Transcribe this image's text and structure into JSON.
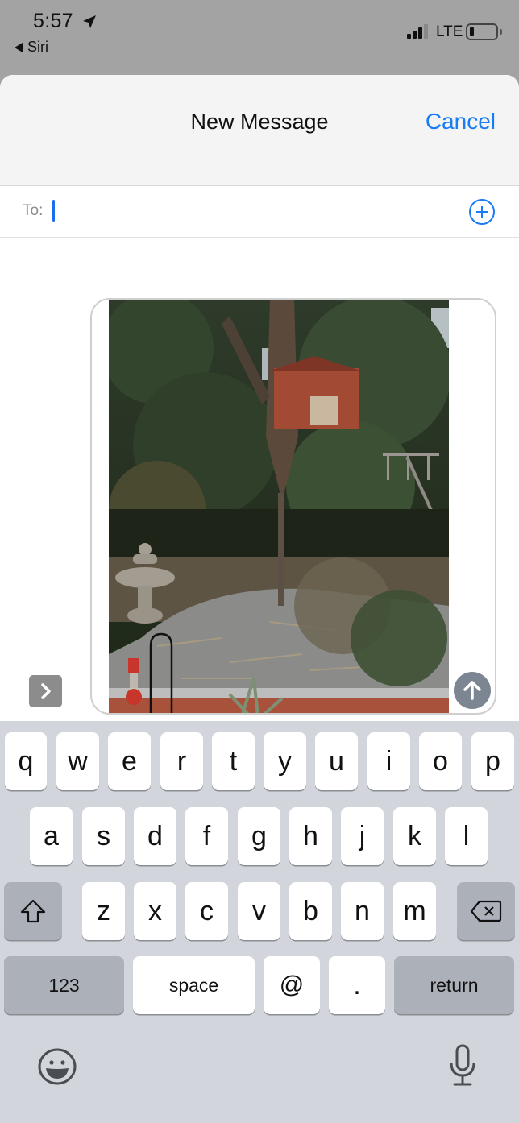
{
  "status_bar": {
    "time": "5:57",
    "back_label": "Siri",
    "network": "LTE",
    "signal_bars": 3,
    "signal_bars_total": 4,
    "battery_level": 0.15,
    "icons": [
      "location-arrow-icon",
      "signal-icon",
      "battery-icon"
    ]
  },
  "nav": {
    "title": "New Message",
    "cancel_label": "Cancel",
    "accent_color": "#1a7cf5"
  },
  "recipients": {
    "label": "To:",
    "value": "",
    "add_icon": "plus-circle-icon"
  },
  "compose": {
    "attachment": "photo of a treehouse in a large oak tree above a backyard patio with a stone fountain and hummingbird feeder",
    "expand_icon": "chevron-right-icon",
    "send_icon": "arrow-up-icon",
    "send_color": "#7c8592"
  },
  "keyboard": {
    "row1": [
      "q",
      "w",
      "e",
      "r",
      "t",
      "y",
      "u",
      "i",
      "o",
      "p"
    ],
    "row2": [
      "a",
      "s",
      "d",
      "f",
      "g",
      "h",
      "j",
      "k",
      "l"
    ],
    "row3": [
      "z",
      "x",
      "c",
      "v",
      "b",
      "n",
      "m"
    ],
    "shift_icon": "shift-icon",
    "delete_icon": "delete-backward-icon",
    "numbers_label": "123",
    "space_label": "space",
    "at_label": "@",
    "period_label": ".",
    "return_label": "return",
    "emoji_icon": "emoji-icon",
    "mic_icon": "microphone-icon"
  }
}
